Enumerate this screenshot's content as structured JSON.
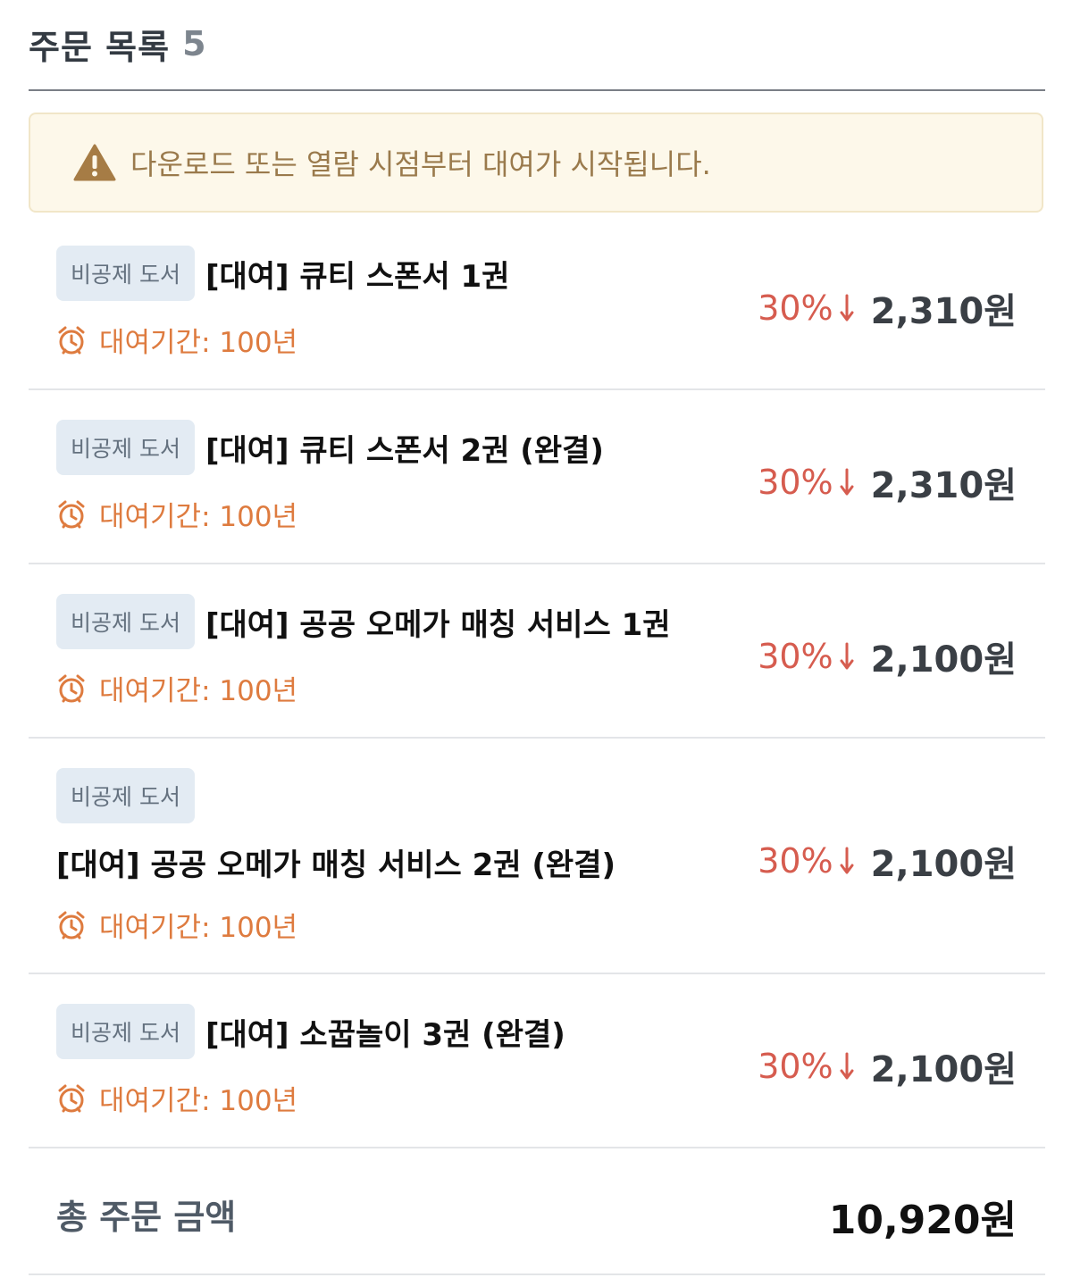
{
  "header": {
    "title": "주문 목록",
    "count": "5"
  },
  "notice": {
    "icon": "warning-icon",
    "text": "다운로드 또는 열람 시점부터 대여가 시작됩니다."
  },
  "items": [
    {
      "badge": "비공제 도서",
      "title": "[대여] 큐티 스폰서 1권",
      "period": "대여기간: 100년",
      "discount": "30%",
      "price": "2,310원"
    },
    {
      "badge": "비공제 도서",
      "title": "[대여] 큐티 스폰서 2권 (완결)",
      "period": "대여기간: 100년",
      "discount": "30%",
      "price": "2,310원"
    },
    {
      "badge": "비공제 도서",
      "title": "[대여] 공공 오메가 매칭 서비스 1권",
      "period": "대여기간: 100년",
      "discount": "30%",
      "price": "2,100원"
    },
    {
      "badge": "비공제 도서",
      "title": "[대여] 공공 오메가 매칭 서비스 2권 (완결)",
      "period": "대여기간: 100년",
      "discount": "30%",
      "price": "2,100원"
    },
    {
      "badge": "비공제 도서",
      "title": "[대여] 소꿉놀이 3권 (완결)",
      "period": "대여기간: 100년",
      "discount": "30%",
      "price": "2,100원"
    }
  ],
  "total": {
    "label": "총 주문 금액",
    "amount": "10,920원"
  },
  "colors": {
    "discount": "#d65c4f",
    "period": "#de7b3f",
    "notice_bg": "#fdf8ea",
    "badge_bg": "#e3ebf3"
  }
}
